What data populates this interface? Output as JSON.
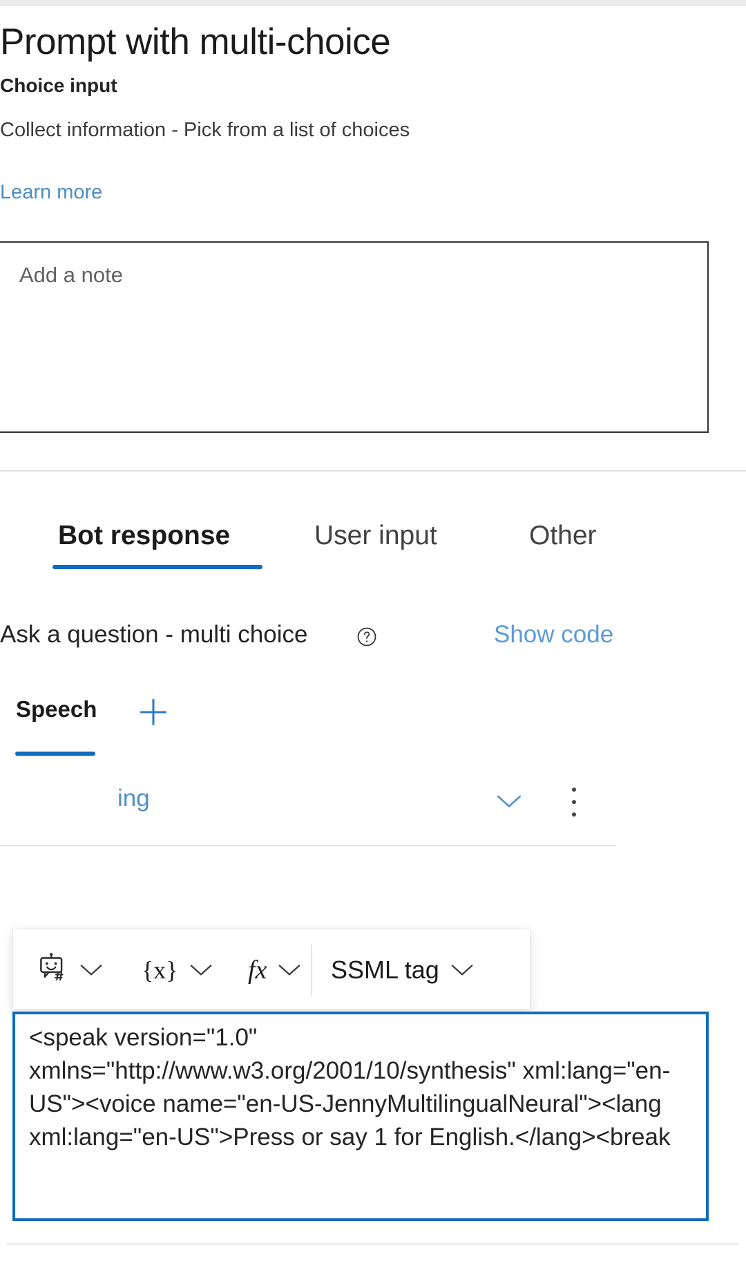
{
  "header": {
    "title": "Prompt with multi-choice",
    "subtitle": "Choice input",
    "description": "Collect information - Pick from a list of choices",
    "learn_more_label": "Learn more"
  },
  "note": {
    "placeholder": "Add a note",
    "value": ""
  },
  "tabs": {
    "items": [
      {
        "label": "Bot response",
        "active": true
      },
      {
        "label": "User input",
        "active": false
      },
      {
        "label": "Other",
        "active": false
      }
    ]
  },
  "question": {
    "label": "Ask a question - multi choice",
    "help_icon": "help-circle-icon",
    "show_code_label": "Show code"
  },
  "speech": {
    "tab_label": "Speech",
    "add_icon": "plus-icon"
  },
  "behind_row": {
    "partial_text": "ing",
    "chevron_icon": "chevron-down-icon",
    "more_icon": "more-vertical-icon"
  },
  "toolbar": {
    "bot_icon": "bot-variable-icon",
    "bot_chevron": "chevron-down-icon",
    "variable_label": "{x}",
    "variable_chevron": "chevron-down-icon",
    "formula_label": "fx",
    "formula_chevron": "chevron-down-icon",
    "ssml_label": "SSML tag",
    "ssml_chevron": "chevron-down-icon"
  },
  "code": {
    "value": "<speak version=\"1.0\" xmlns=\"http://www.w3.org/2001/10/synthesis\" xml:lang=\"en-US\"><voice name=\"en-US-JennyMultilingualNeural\"><lang xml:lang=\"en-US\">Press or say 1 for English.</lang><break"
  },
  "colors": {
    "accent": "#0f6cbd",
    "link": "#5c9bd6",
    "learn_more_link": "#4a8ec2",
    "text": "#242424",
    "border": "#333333"
  }
}
